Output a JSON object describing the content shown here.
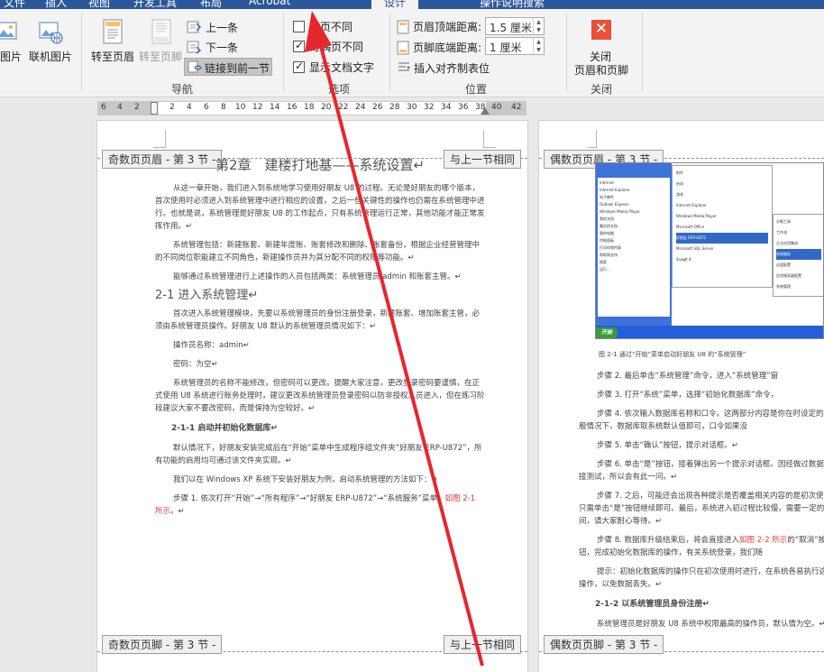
{
  "tabs": [
    "文件",
    "插入",
    "视图",
    "开发工具",
    "布局",
    "Acrobat",
    "设计",
    "操作说明搜索"
  ],
  "ribbon": {
    "images": {
      "picture_label": "图片",
      "online_picture_label": "联机图片"
    },
    "nav": {
      "goto_header": "转至页眉",
      "goto_footer": "转至页脚",
      "prev_section": "上一条",
      "next_section": "下一条",
      "link_prev": "链接到前一节",
      "group_label": "导航"
    },
    "options": {
      "diff_first_page": "首页不同",
      "diff_odd_even": "奇偶页不同",
      "show_doc_text": "显示文档文字",
      "group_label": "选项"
    },
    "position": {
      "header_top_label": "页眉顶端距离:",
      "header_top_value": "1.5 厘米",
      "footer_bottom_label": "页脚底端距离:",
      "footer_bottom_value": "1 厘米",
      "insert_align_tab": "插入对齐制表位",
      "group_label": "位置"
    },
    "close": {
      "label_line1": "关闭",
      "label_line2": "页眉和页脚",
      "group_label": "关闭"
    }
  },
  "ruler_ticks": [
    "6",
    "4",
    "2",
    "2",
    "4",
    "6",
    "8",
    "10",
    "12",
    "14",
    "16",
    "18",
    "20",
    "22",
    "24",
    "26",
    "28",
    "30",
    "32",
    "34",
    "36",
    "38",
    "40",
    "42"
  ],
  "left_page": {
    "header_tag": "奇数页页眉 - 第 3 节 -",
    "same_as_prev_top": "与上一节相同",
    "footer_tag": "奇数页页脚 - 第 3 节 -",
    "same_as_prev_bottom": "与上一节相同",
    "title": "第2章　建楼打地基——系统设置↵",
    "paras": [
      "从这一章开始，我们进入到系统地学习使用好朋友 U8 的过程。无论是好朋友的哪个版本，首次使用时必须进入到系统管理中进行相应的设置，之后一些关键性的操作也仍需在系统管理中进行。也就是说，系统管理是好朋友 U8 的工作起点，只有系统管理运行正常，其他功能才能正常发挥作用。↵",
      "系统管理包括：新建账套、新建年度账、账套修改和删除、账套备份，根据企业经营管理中的不同岗位职能建立不同角色，新建操作员并为其分配不同的权限等功能。↵",
      "能够通过系统管理进行上述操作的人员包括两类：系统管理员 admin 和账套主管。↵"
    ],
    "h2": "2-1 进入系统管理↵",
    "paras2": [
      "首次进入系统管理模块，先要以系统管理员的身份注册登录，新建账套、增加账套主管，必须由系统管理员操作。好朋友 U8 默认的系统管理员情况如下：↵",
      "操作员名称：admin↵",
      "密码：为空↵",
      "系统管理员的名称不能修改，但密码可以更改。提醒大家注意，更改登录密码要谨慎，在正式使用 U8 系统进行账务处理时，建议更改系统管理员登录密码以防非授权人员进入，但在练习阶段建议大家不要改密码，而是保持为空较好。↵"
    ],
    "h3": "2-1-1 启动并初始化数据库↵",
    "paras3": [
      "默认情况下，好朋友安装完成后在“开始”菜单中生成程序组文件夹“好朋友 ERP-U872”，所有功能的启用均可通过该文件夹实现。↵",
      "我们以在 Windows XP 系统下安装好朋友为例，启动系统管理的方法如下：↵"
    ],
    "step1_a": "步骤 1. 依次打开“开始”→“所有程序”→“好朋友 ERP-U872”→“系统服务”菜单，",
    "step1_red": "如图 2-1 所示",
    "step1_b": "。↵"
  },
  "right_page": {
    "header_tag": "偶数页页眉 - 第 3 节 -",
    "footer_tag": "偶数页页脚 - 第 3 节 -",
    "caption": "图 2-1 通过“开始”菜单启动好朋友 U8 的“系统管理”",
    "paras": [
      "步骤 2. 最后单击“系统管理”命令，进入“系统管理”窗",
      "步骤 3. 打开“系统”菜单，选择“初始化数据库”命令，",
      "步骤 4. 依次输入数据库名称和口令。这两部分内容是你在时设定的。一般情况下，数据库取系统默认值即可，口令如果没",
      "步骤 5. 单击“确认”按钮，提示对话框。↵",
      "步骤 6. 单击“是”按钮，接着弹出另一个提示对话框。因经做过数据库连接测试，所以会有此一问。↵",
      "步骤 7. 之后，可能还会出现各种提示是否覆盖相关内容的是初次使用，只需单击“是”按钮继续即可。最后，系统进入初过程比较慢，需要一定的时间，请大家耐心等待。↵"
    ],
    "step8_a": "步骤 8. 数据库升级结束后，将会直接进入",
    "step8_red": "如图 2-2 所示",
    "step8_b": "的“取消”按钮，完成初始化数据库的操作，有关系统登录，我们随",
    "tip": "提示：初始化数据库的操作只在初次使用时进行，在系统各易执行这一操作，以免数据丢失。↵",
    "h3": "2-1-2 以系统管理员身份注册↵",
    "last": "系统管理员是好朋友 U8 系统中权限最高的操作员，默认情为空。↵"
  },
  "figure": {
    "start_items": [
      "Internet",
      "Internet Explorer",
      "电子邮件",
      "Outlook Express",
      "Windows Media Player",
      "我的文档",
      "最近的文档",
      "我的电脑",
      "控制面板",
      "打印机和传真",
      "帮助和支持",
      "搜索",
      "运行..."
    ],
    "submenu": [
      "附件",
      "启动",
      "游戏",
      "Internet Explorer",
      "Windows Media Player",
      "Microsoft Office",
      "好朋友 ERP-U872",
      "Microsoft SQL Server",
      "SnagIt 8"
    ],
    "submenu2": [
      "诊断工具",
      "工作流",
      "企业应用集成",
      "系统服务",
      "远程配置",
      "应用服务器配置",
      "系统管理"
    ],
    "start_button": "开始"
  },
  "colors": {
    "ribbon_blue": "#2b579a",
    "arrow_red": "#e8262d",
    "close_red": "#e8503a"
  }
}
